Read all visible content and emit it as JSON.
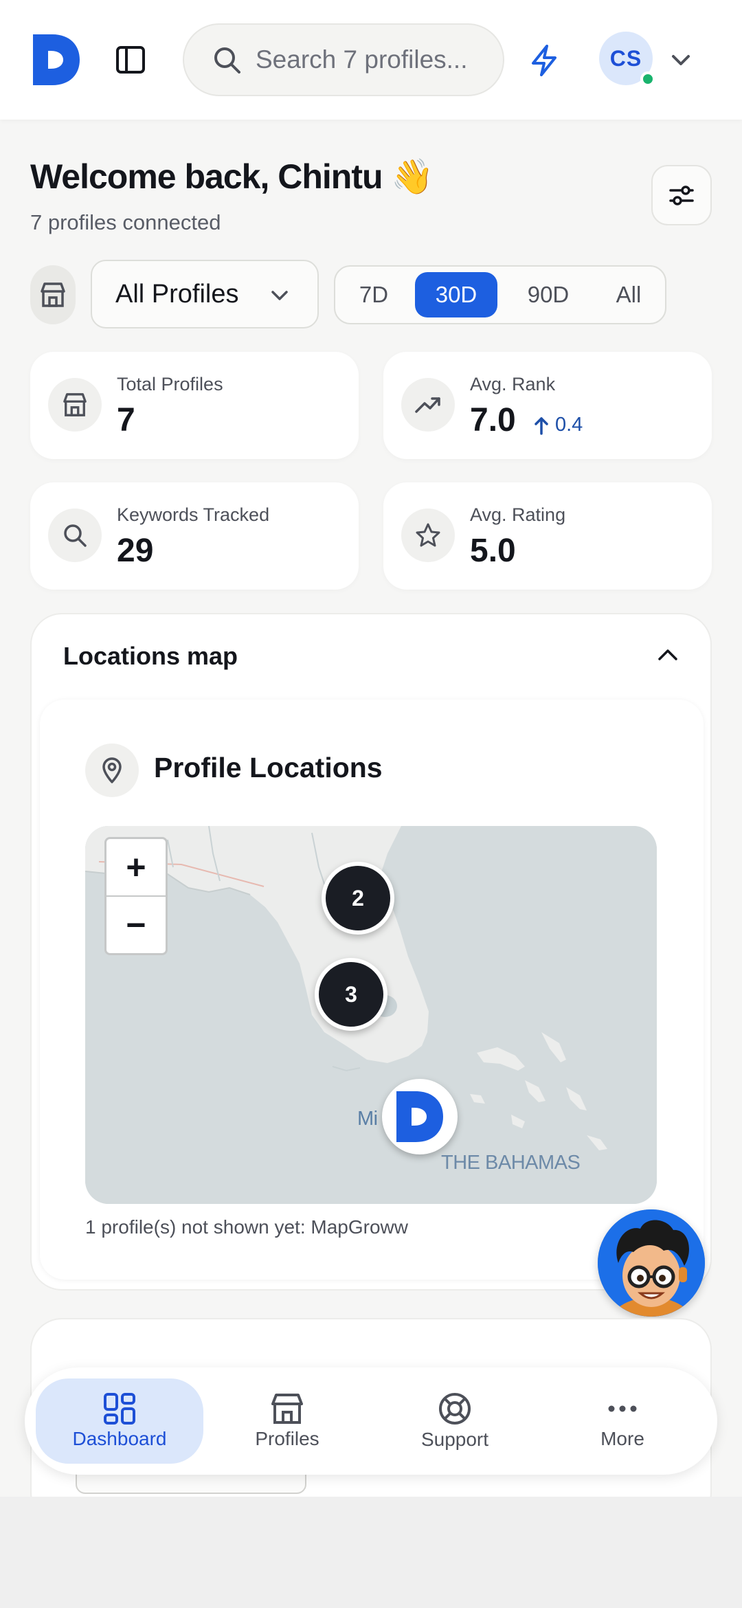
{
  "header": {
    "search_placeholder": "Search 7 profiles...",
    "avatar_initials": "CS"
  },
  "welcome": {
    "title": "Welcome back, Chintu 👋",
    "subtitle": "7 profiles connected"
  },
  "filters": {
    "profile_select": "All Profiles",
    "ranges": [
      "7D",
      "30D",
      "90D",
      "All"
    ],
    "active_range": "30D"
  },
  "stats": [
    {
      "label": "Total Profiles",
      "value": "7",
      "icon": "store-icon"
    },
    {
      "label": "Avg. Rank",
      "value": "7.0",
      "delta": "0.4",
      "icon": "trending-up-icon"
    },
    {
      "label": "Keywords Tracked",
      "value": "29",
      "icon": "search-icon"
    },
    {
      "label": "Avg. Rating",
      "value": "5.0",
      "icon": "star-icon"
    }
  ],
  "locations": {
    "section_title": "Locations map",
    "card_title": "Profile Locations",
    "clusters": [
      "2",
      "3"
    ],
    "map_labels": {
      "city_partial": "Mi",
      "country": "THE BAHAMAS"
    },
    "zoom_in": "+",
    "zoom_out": "−",
    "not_shown_note": "1 profile(s) not shown yet: MapGroww"
  },
  "bottom_nav": [
    {
      "label": "Dashboard",
      "icon": "dashboard-icon",
      "active": true
    },
    {
      "label": "Profiles",
      "icon": "store-icon",
      "active": false
    },
    {
      "label": "Support",
      "icon": "lifebuoy-icon",
      "active": false
    },
    {
      "label": "More",
      "icon": "more-icon",
      "active": false
    }
  ],
  "colors": {
    "accent": "#1d5fe0",
    "online": "#19b36d",
    "cluster": "#1a1d24"
  }
}
